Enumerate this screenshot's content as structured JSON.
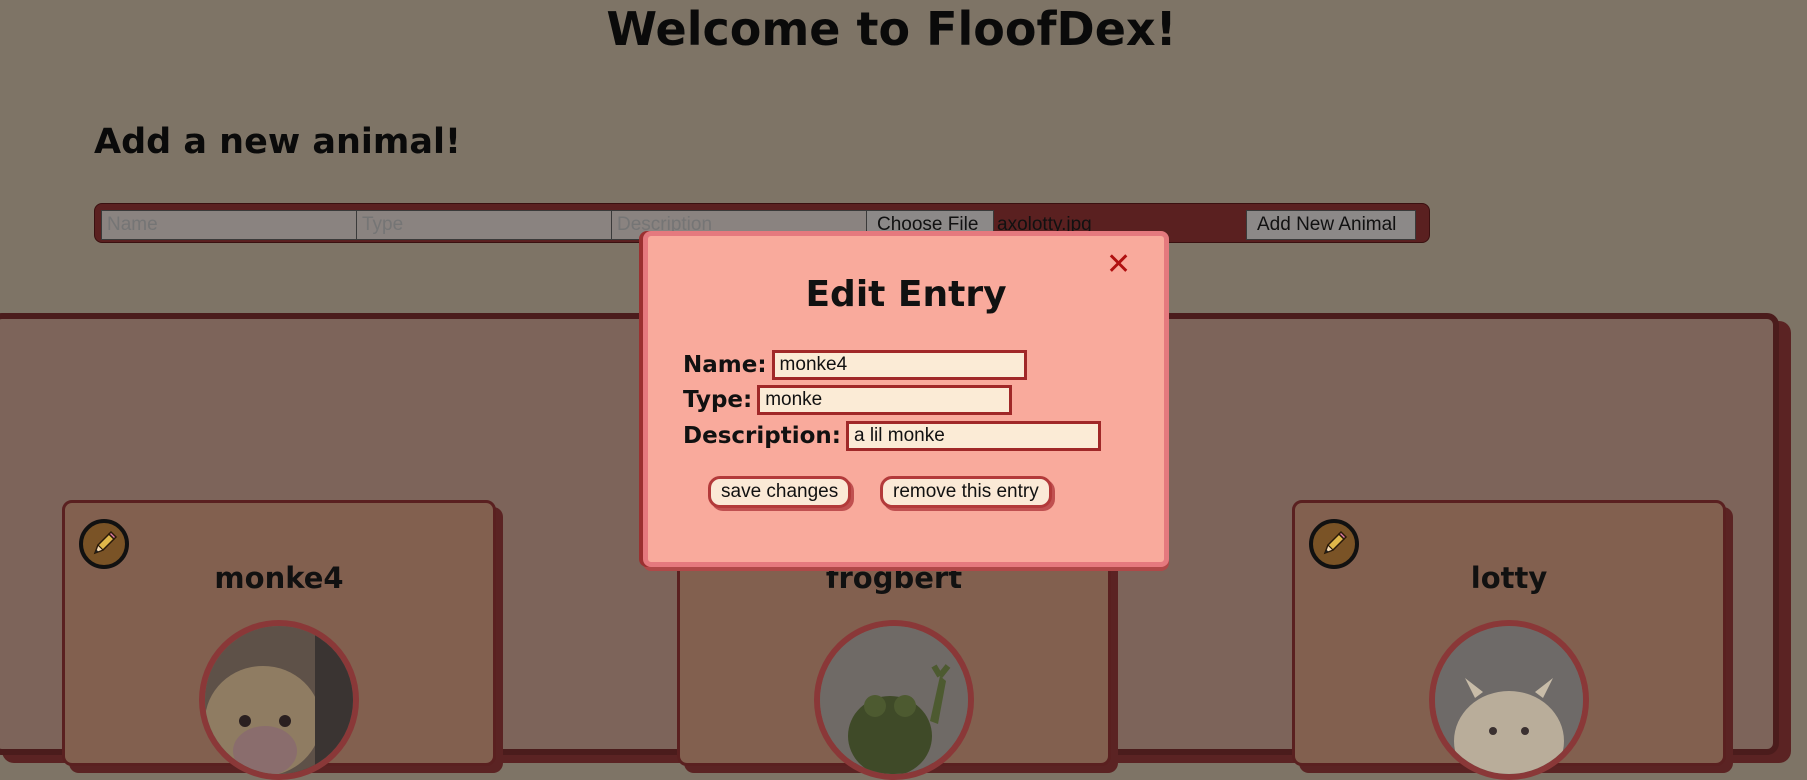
{
  "header": {
    "title": "Welcome to FloofDex!"
  },
  "add_form": {
    "heading": "Add a new animal!",
    "name_placeholder": "Name",
    "type_placeholder": "Type",
    "description_placeholder": "Description",
    "choose_file_label": "Choose File",
    "file_name": "axolotty.jpg",
    "submit_label": "Add New Animal"
  },
  "cards": [
    {
      "name": "monke4",
      "edit_icon": "pencil-icon"
    },
    {
      "name": "frogbert",
      "edit_icon": "pencil-icon"
    },
    {
      "name": "lotty",
      "edit_icon": "pencil-icon"
    }
  ],
  "modal": {
    "title": "Edit Entry",
    "close_icon": "close-icon",
    "name_label": "Name:",
    "name_value": "monke4",
    "type_label": "Type:",
    "type_value": "monke",
    "description_label": "Description:",
    "description_value": "a lil monke",
    "save_label": "save changes",
    "remove_label": "remove this entry"
  },
  "colors": {
    "overlay_bg": "#7e7466",
    "modal_bg": "#f9aa9c",
    "accent_dark": "#5a2020",
    "close_x": "#b01010",
    "input_bg": "#fbebd6"
  }
}
